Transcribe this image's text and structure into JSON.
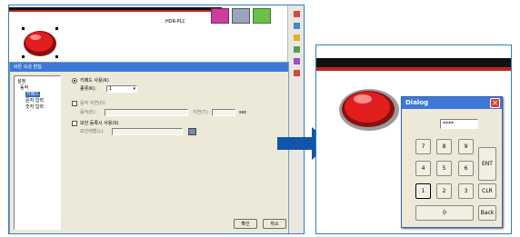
{
  "left_panel": {
    "top_header_text": "HDR-PLC",
    "dialog_title": "버튼 속성 편집",
    "tree": {
      "root": "설정",
      "child": "동작",
      "selected": "키패드",
      "items": [
        "문자 입력",
        "숫자 입력"
      ]
    },
    "option1_label": "키패드 사용(K)",
    "option1_field_label": "종류(K):",
    "option1_value": "1",
    "option2_label": "동작 지연(D)",
    "option2_field_label": "동작(E):",
    "option2_field2_label": "지연(T):",
    "option2_unit": "sec",
    "option3_label": "보안 등록시 사용(S)",
    "option3_field_label": "보안레벨(L):",
    "ok_label": "확인",
    "cancel_label": "취소"
  },
  "dialog": {
    "title": "Dialog",
    "display_value": "****",
    "keys": [
      "7",
      "8",
      "9",
      "ENT",
      "4",
      "5",
      "6",
      "1",
      "2",
      "3",
      "CLR",
      "0",
      "Back"
    ]
  },
  "arrow_icon": "right-arrow-icon",
  "colors": {
    "frame_blue": "#2f7fc0",
    "arrow_blue": "#1155aa",
    "xp_title": "#3d78d8",
    "close_red": "#d9412a",
    "panel_bg": "#ece9d8"
  }
}
